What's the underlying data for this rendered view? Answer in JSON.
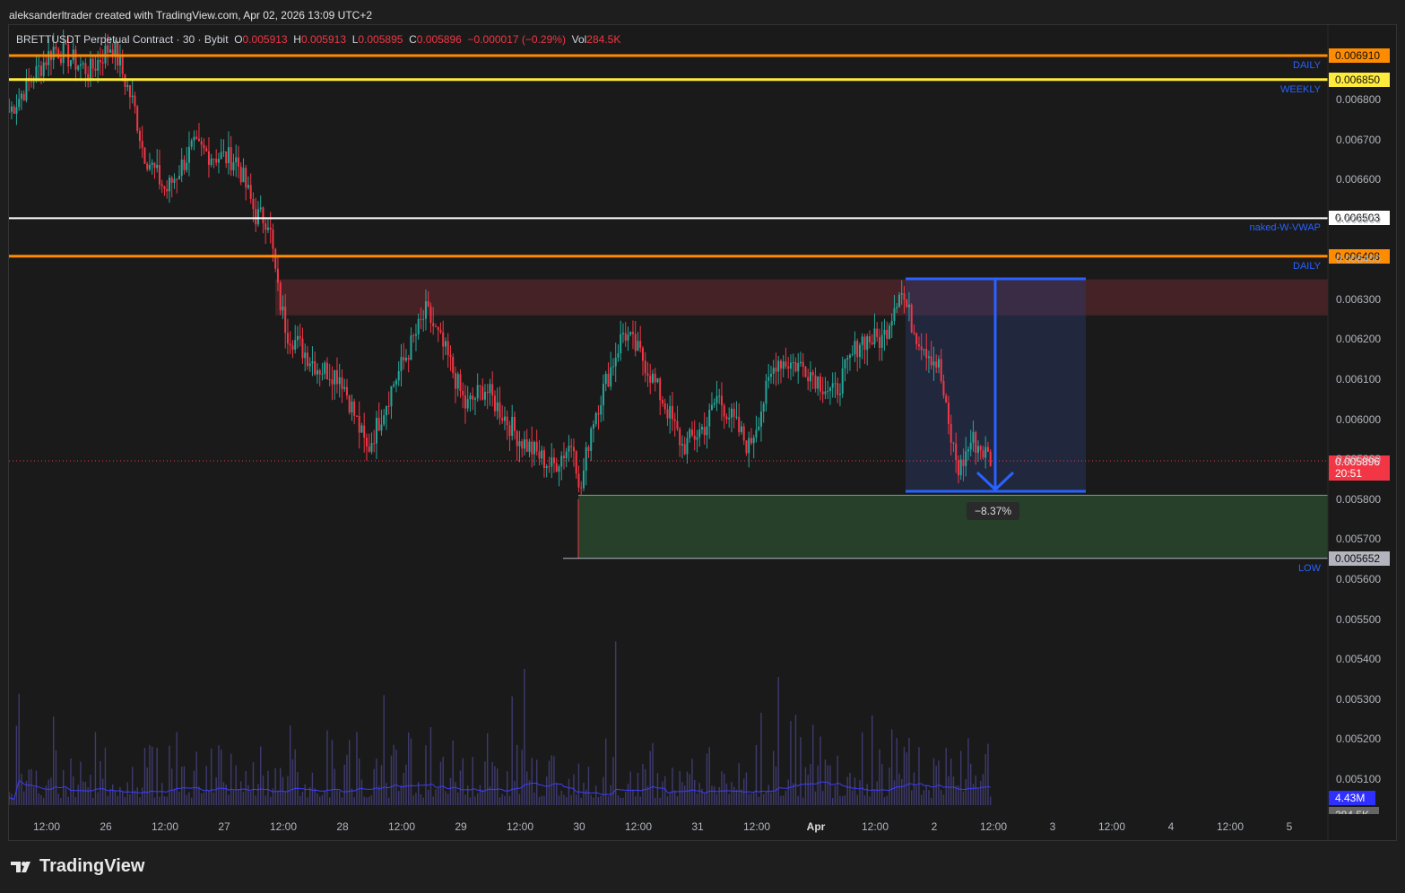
{
  "credit": "aleksanderltrader created with TradingView.com, Apr 02, 2026 13:09 UTC+2",
  "legend": {
    "symbol": "BRETTUSDT Perpetual Contract · 30 · Bybit",
    "o_label": "O",
    "o": "0.005913",
    "h_label": "H",
    "h": "0.005913",
    "l_label": "L",
    "l": "0.005895",
    "c_label": "C",
    "c": "0.005896",
    "change": "−0.000017 (−0.29%)",
    "vol_label": "Vol",
    "vol": "284.5K"
  },
  "price_axis": [
    "0.006800",
    "0.006700",
    "0.006600",
    "0.006500",
    "0.006400",
    "0.006300",
    "0.006200",
    "0.006100",
    "0.006000",
    "0.005900",
    "0.005800",
    "0.005700",
    "0.005600",
    "0.005500",
    "0.005400",
    "0.005300",
    "0.005200",
    "0.005100"
  ],
  "levels": [
    {
      "price": 0.00691,
      "label": "0.006910",
      "name": "DAILY",
      "color": "#ff8c00"
    },
    {
      "price": 0.00685,
      "label": "0.006850",
      "name": "WEEKLY",
      "color": "#ffeb3b"
    },
    {
      "price": 0.006503,
      "label": "0.006503",
      "name": "naked-W-VWAP",
      "color": "#ffffff"
    },
    {
      "price": 0.006408,
      "label": "0.006408",
      "name": "DAILY",
      "color": "#ff8c00"
    },
    {
      "price": 0.005652,
      "label": "0.005652",
      "name": "LOW",
      "color": "#b2b5be"
    }
  ],
  "current_price": {
    "label": "0.005896",
    "countdown": "20:51",
    "color": "#f23645"
  },
  "volume_tags": {
    "ma": "4.43M",
    "vol": "284.5K"
  },
  "measure": {
    "label": "−8.37%"
  },
  "time_axis": [
    "12:00",
    "26",
    "12:00",
    "27",
    "12:00",
    "28",
    "12:00",
    "29",
    "12:00",
    "30",
    "12:00",
    "31",
    "12:00",
    "Apr",
    "12:00",
    "2",
    "12:00",
    "3",
    "12:00",
    "4",
    "12:00",
    "5"
  ],
  "chart_data": {
    "type": "candlestick",
    "interval_min": 30,
    "waypoints_hours_price": [
      [
        -7.6,
        0.00677
      ],
      [
        1.5,
        0.00693
      ],
      [
        8.7,
        0.00687
      ],
      [
        13.3,
        0.00694
      ],
      [
        17.8,
        0.00678
      ],
      [
        19.6,
        0.00667
      ],
      [
        24.2,
        0.00657
      ],
      [
        29.6,
        0.00668
      ],
      [
        34,
        0.00666
      ],
      [
        38.5,
        0.00665
      ],
      [
        42.4,
        0.00651
      ],
      [
        45,
        0.0065
      ],
      [
        47,
        0.00631
      ],
      [
        48.7,
        0.00622
      ],
      [
        55,
        0.00613
      ],
      [
        59.6,
        0.00611
      ],
      [
        65,
        0.00592
      ],
      [
        70,
        0.00608
      ],
      [
        77,
        0.00627
      ],
      [
        81.5,
        0.00615
      ],
      [
        85,
        0.00603
      ],
      [
        88.7,
        0.00608
      ],
      [
        96,
        0.00595
      ],
      [
        102.5,
        0.00588
      ],
      [
        107,
        0.00595
      ],
      [
        108,
        0.0058
      ],
      [
        110.5,
        0.00599
      ],
      [
        117,
        0.00622
      ],
      [
        121,
        0.00615
      ],
      [
        126,
        0.00602
      ],
      [
        129,
        0.00593
      ],
      [
        134,
        0.00599
      ],
      [
        136,
        0.00606
      ],
      [
        142.4,
        0.00593
      ],
      [
        148,
        0.00615
      ],
      [
        154,
        0.00613
      ],
      [
        159.6,
        0.00606
      ],
      [
        165,
        0.0062
      ],
      [
        169.6,
        0.0062
      ],
      [
        173,
        0.00633
      ],
      [
        176,
        0.00622
      ],
      [
        181,
        0.00613
      ],
      [
        183,
        0.00597
      ],
      [
        185,
        0.00587
      ],
      [
        187.6,
        0.00595
      ],
      [
        191.8,
        0.005896
      ]
    ],
    "zones": {
      "resistance": [
        0.00626,
        0.00635
      ],
      "support": [
        0.005652,
        0.00581
      ]
    }
  }
}
